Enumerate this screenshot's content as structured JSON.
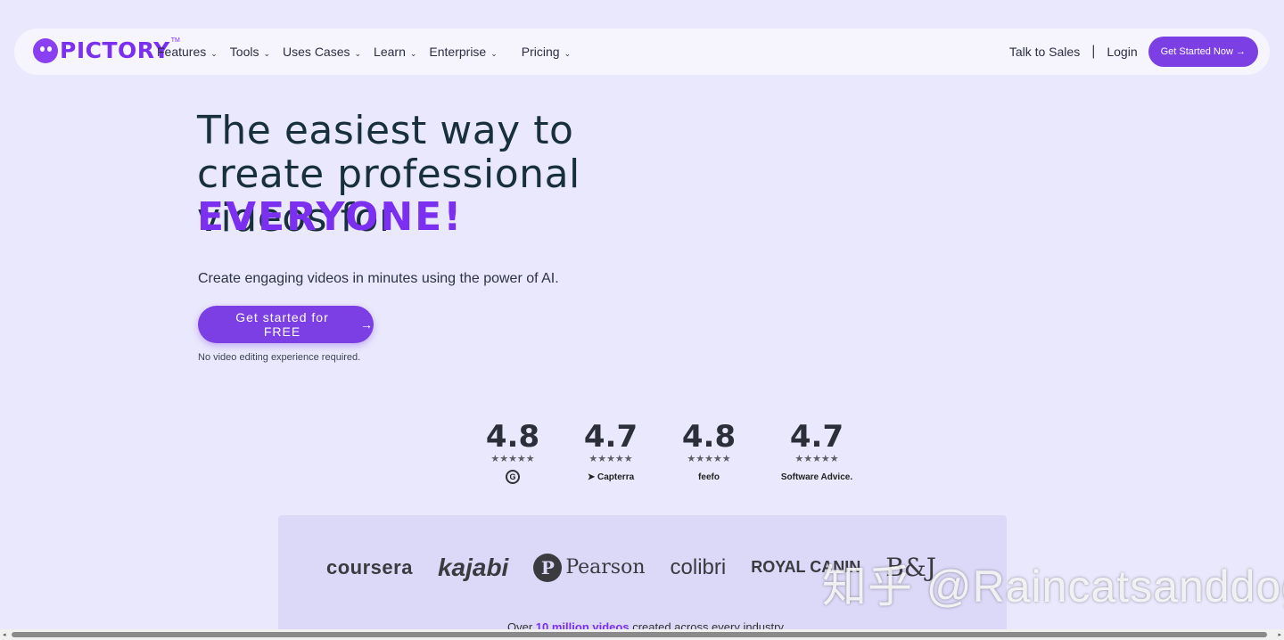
{
  "nav": {
    "brand": "PICTORY",
    "brand_tm": "TM",
    "menu": [
      {
        "label": "Features"
      },
      {
        "label": "Tools"
      },
      {
        "label": "Uses Cases"
      },
      {
        "label": "Learn"
      },
      {
        "label": "Enterprise"
      },
      {
        "label": "Pricing"
      }
    ],
    "talk_to_sales": "Talk to Sales",
    "separator": "|",
    "login": "Login",
    "cta": "Get Started Now →"
  },
  "hero": {
    "title": "The easiest way to create professional videos for",
    "accent": "EVERYONE!",
    "subtitle": "Create engaging videos in minutes using the power of AI.",
    "cta": "Get started for FREE",
    "cta_arrow": "→",
    "note": "No video editing experience required."
  },
  "ratings": [
    {
      "score": "4.8",
      "stars": "★★★★★",
      "source": "G"
    },
    {
      "score": "4.7",
      "stars": "★★★★★",
      "source": "Capterra"
    },
    {
      "score": "4.8",
      "stars": "★★★★★",
      "source": "feefo"
    },
    {
      "score": "4.7",
      "stars": "★★★★★",
      "source": "Software Advice."
    }
  ],
  "brands": {
    "coursera": "coursera",
    "kajabi": "kajabi",
    "pearson_mark": "P",
    "pearson": "Pearson",
    "colibri": "colibri",
    "royal": "ROYAL CANIN",
    "bj": "B&J"
  },
  "tagline": {
    "before": "Over",
    "highlight": "10 million videos",
    "after": "created across every industry"
  },
  "watermark": "知乎 @Raincatsanddogs",
  "scroll": {
    "left_arrow": "◂",
    "right_arrow": "▸"
  },
  "colors": {
    "accent": "#7b2ff0",
    "button": "#7b3fe4",
    "background": "#eae8fc"
  }
}
